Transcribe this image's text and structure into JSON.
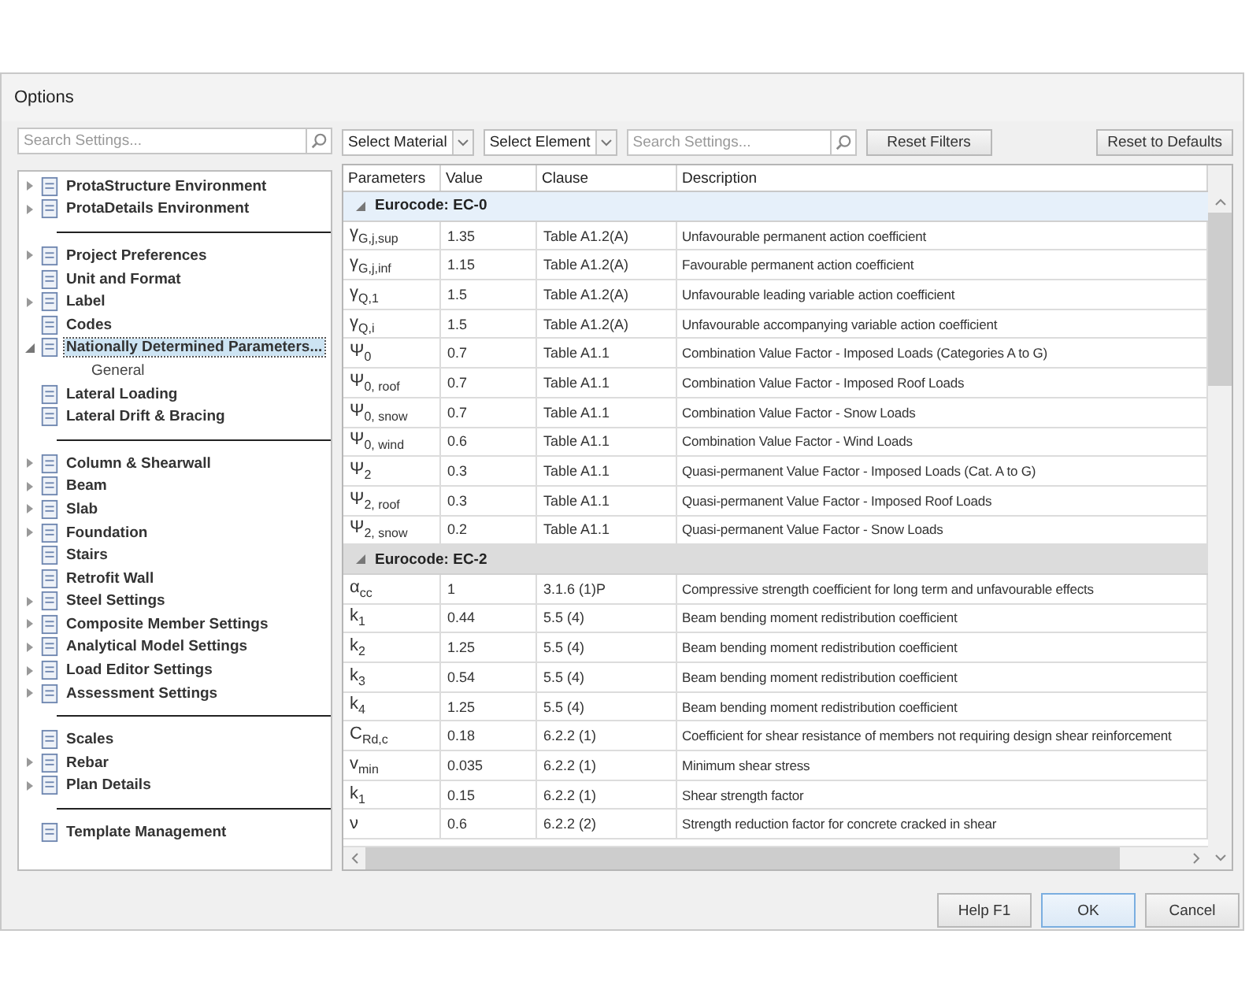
{
  "window": {
    "title": "Options"
  },
  "sidebar": {
    "search": {
      "placeholder": "Search Settings..."
    },
    "sections": [
      {
        "items": [
          {
            "label": "ProtaStructure Environment",
            "kind": "branch",
            "expanded": false,
            "selected": false
          },
          {
            "label": "ProtaDetails Environment",
            "kind": "branch",
            "expanded": false,
            "selected": false
          }
        ]
      },
      {
        "items": [
          {
            "label": "Project Preferences",
            "kind": "branch",
            "expanded": false,
            "selected": false
          },
          {
            "label": "Unit and Format",
            "kind": "leaf",
            "expanded": false,
            "selected": false
          },
          {
            "label": "Label",
            "kind": "branch",
            "expanded": false,
            "selected": false
          },
          {
            "label": "Codes",
            "kind": "leaf",
            "expanded": false,
            "selected": false
          },
          {
            "label": "Nationally Determined Parameters...",
            "kind": "branch",
            "expanded": true,
            "selected": true,
            "children": [
              {
                "label": "General"
              }
            ]
          },
          {
            "label": "Lateral Loading",
            "kind": "leaf",
            "expanded": false,
            "selected": false
          },
          {
            "label": "Lateral Drift & Bracing",
            "kind": "leaf",
            "expanded": false,
            "selected": false
          }
        ]
      },
      {
        "items": [
          {
            "label": "Column & Shearwall",
            "kind": "branch",
            "expanded": false,
            "selected": false
          },
          {
            "label": "Beam",
            "kind": "branch",
            "expanded": false,
            "selected": false
          },
          {
            "label": "Slab",
            "kind": "branch",
            "expanded": false,
            "selected": false
          },
          {
            "label": "Foundation",
            "kind": "branch",
            "expanded": false,
            "selected": false
          },
          {
            "label": "Stairs",
            "kind": "leaf",
            "expanded": false,
            "selected": false
          },
          {
            "label": "Retrofit Wall",
            "kind": "leaf",
            "expanded": false,
            "selected": false
          },
          {
            "label": "Steel Settings",
            "kind": "branch",
            "expanded": false,
            "selected": false
          },
          {
            "label": "Composite Member Settings",
            "kind": "branch",
            "expanded": false,
            "selected": false
          },
          {
            "label": "Analytical Model Settings",
            "kind": "branch",
            "expanded": false,
            "selected": false
          },
          {
            "label": "Load Editor Settings",
            "kind": "branch",
            "expanded": false,
            "selected": false
          },
          {
            "label": "Assessment Settings",
            "kind": "branch",
            "expanded": false,
            "selected": false
          }
        ]
      },
      {
        "items": [
          {
            "label": "Scales",
            "kind": "leaf",
            "expanded": false,
            "selected": false
          },
          {
            "label": "Rebar",
            "kind": "branch",
            "expanded": false,
            "selected": false
          },
          {
            "label": "Plan Details",
            "kind": "branch",
            "expanded": false,
            "selected": false
          }
        ]
      },
      {
        "items": [
          {
            "label": "Template Management",
            "kind": "leaf",
            "expanded": false,
            "selected": false
          }
        ]
      }
    ]
  },
  "toolbar": {
    "material": "Select Material",
    "element": "Select Element",
    "search": {
      "placeholder": "Search Settings..."
    },
    "reset_filters": "Reset Filters",
    "reset_defaults": "Reset to Defaults"
  },
  "table": {
    "columns": [
      "Parameters",
      "Value",
      "Clause",
      "Description"
    ],
    "groups": [
      {
        "title": "Eurocode: EC-0",
        "expanded": true,
        "selected": true,
        "rows": [
          [
            "γ$_{G,j,sup}$",
            "1.35",
            "Table A1.2(A)",
            "Unfavourable permanent action coefficient"
          ],
          [
            "γ$_{G,j,inf}$",
            "1.15",
            "Table A1.2(A)",
            "Favourable permanent action coefficient"
          ],
          [
            "γ$_{Q,1}$",
            "1.5",
            "Table A1.2(A)",
            "Unfavourable leading variable action coefficient"
          ],
          [
            "γ$_{Q,i}$",
            "1.5",
            "Table A1.2(A)",
            "Unfavourable accompanying variable action coefficient"
          ],
          [
            "Ψ$_{0}$",
            "0.7",
            "Table A1.1",
            "Combination Value Factor - Imposed Loads (Categories A to G)"
          ],
          [
            "Ψ$_{0, roof}$",
            "0.7",
            "Table A1.1",
            "Combination Value Factor - Imposed Roof Loads"
          ],
          [
            "Ψ$_{0, snow}$",
            "0.7",
            "Table A1.1",
            "Combination Value Factor - Snow Loads"
          ],
          [
            "Ψ$_{0, wind}$",
            "0.6",
            "Table A1.1",
            "Combination Value Factor - Wind Loads"
          ],
          [
            "Ψ$_{2}$",
            "0.3",
            "Table A1.1",
            "Quasi-permanent Value Factor - Imposed Loads (Cat. A to G)"
          ],
          [
            "Ψ$_{2, roof}$",
            "0.3",
            "Table A1.1",
            "Quasi-permanent Value Factor - Imposed Roof Loads"
          ],
          [
            "Ψ$_{2, snow}$",
            "0.2",
            "Table A1.1",
            "Quasi-permanent Value Factor - Snow Loads"
          ]
        ]
      },
      {
        "title": "Eurocode: EC-2",
        "expanded": true,
        "selected": false,
        "rows": [
          [
            "α$_{cc}$",
            "1",
            "3.1.6 (1)P",
            "Compressive strength coefficient for long term and unfavourable effects"
          ],
          [
            "k$_{1}$",
            "0.44",
            "5.5 (4)",
            "Beam bending moment redistribution coefficient"
          ],
          [
            "k$_{2}$",
            "1.25",
            "5.5 (4)",
            "Beam bending moment redistribution coefficient"
          ],
          [
            "k$_{3}$",
            "0.54",
            "5.5 (4)",
            "Beam bending moment redistribution coefficient"
          ],
          [
            "k$_{4}$",
            "1.25",
            "5.5 (4)",
            "Beam bending moment redistribution coefficient"
          ],
          [
            "C$_{Rd,c}$",
            "0.18",
            "6.2.2 (1)",
            "Coefficient for shear resistance of members not requiring design shear reinforcement"
          ],
          [
            "v$_{min}$",
            "0.035",
            "6.2.2 (1)",
            "Minimum shear stress"
          ],
          [
            "k$_{1}$",
            "0.15",
            "6.2.2 (1)",
            "Shear strength factor"
          ],
          [
            "ν",
            "0.6",
            "6.2.2 (2)",
            "Strength reduction factor for concrete cracked in shear"
          ]
        ]
      }
    ]
  },
  "buttons": [
    {
      "label": "Help  F1",
      "kind": "help"
    },
    {
      "label": "OK",
      "kind": "default"
    },
    {
      "label": "Cancel",
      "kind": "normal"
    }
  ]
}
